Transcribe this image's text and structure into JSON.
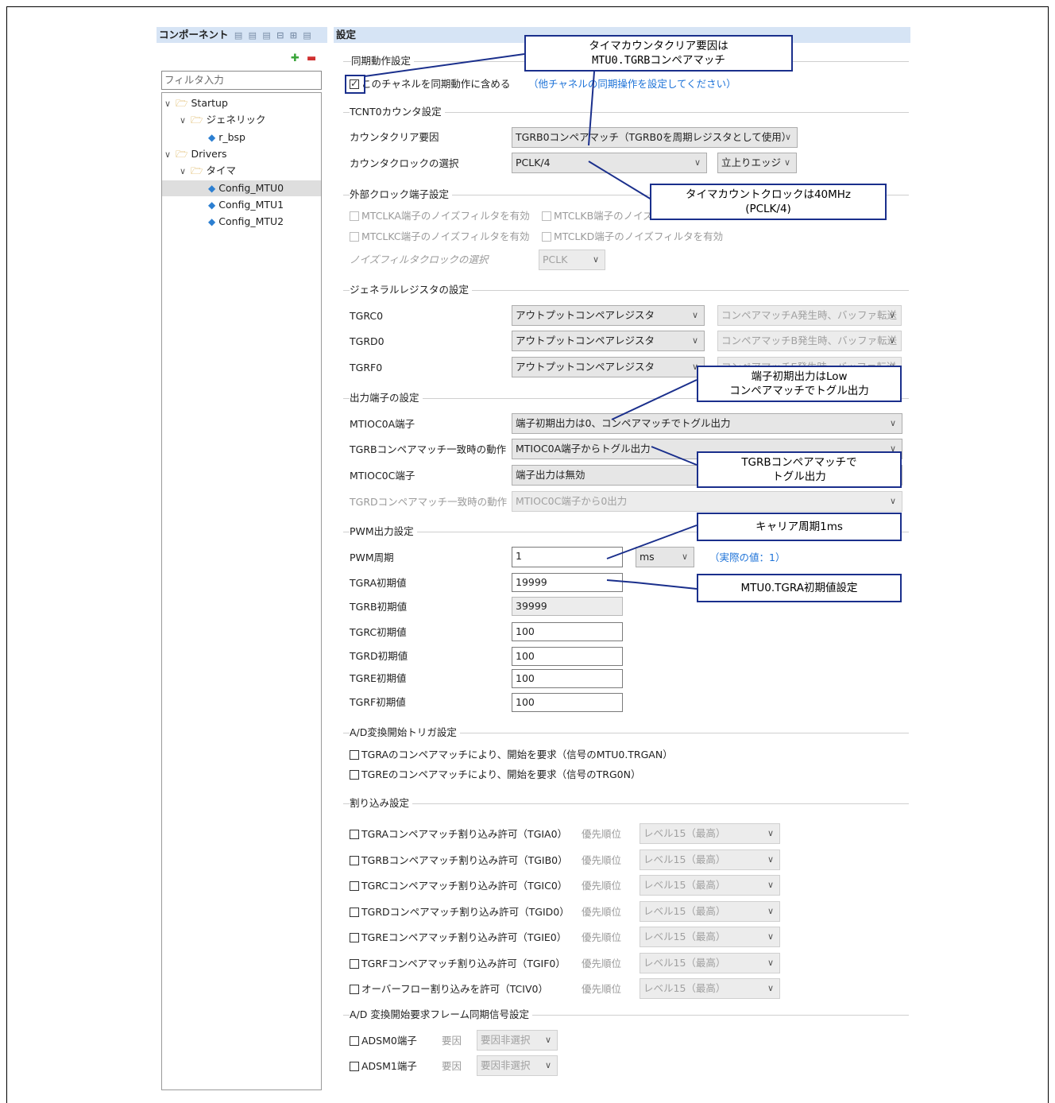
{
  "left_panel": {
    "title": "コンポーネント",
    "toolbar_icons": [
      "▤",
      "▤",
      "▤",
      "⊟",
      "⊞",
      "▤"
    ],
    "filter_placeholder": "フィルタ入力",
    "tree": [
      {
        "label": "Startup",
        "level": 0,
        "type": "folder"
      },
      {
        "label": "ジェネリック",
        "level": 1,
        "type": "folder"
      },
      {
        "label": "r_bsp",
        "level": 2,
        "type": "item"
      },
      {
        "label": "Drivers",
        "level": 0,
        "type": "folder"
      },
      {
        "label": "タイマ",
        "level": 1,
        "type": "folder"
      },
      {
        "label": "Config_MTU0",
        "level": 2,
        "type": "item",
        "selected": true
      },
      {
        "label": "Config_MTU1",
        "level": 2,
        "type": "item"
      },
      {
        "label": "Config_MTU2",
        "level": 2,
        "type": "item"
      }
    ]
  },
  "settings": {
    "title": "設定",
    "sync": {
      "group": "同期動作設定",
      "checkbox_label": "このチャネルを同期動作に含める",
      "link": "（他チャネルの同期操作を設定してください）"
    },
    "tcnt": {
      "group": "TCNT0カウンタ設定",
      "clear_label": "カウンタクリア要因",
      "clear_value": "TGRB0コンペアマッチ（TGRB0を周期レジスタとして使用）",
      "clock_label": "カウンタクロックの選択",
      "clock_value": "PCLK/4",
      "edge_value": "立上りエッジ"
    },
    "ext_clock": {
      "group": "外部クロック端子設定",
      "a": "MTCLKA端子のノイズフィルタを有効",
      "b": "MTCLKB端子のノイズフィルタを有効",
      "c": "MTCLKC端子のノイズフィルタを有効",
      "d": "MTCLKD端子のノイズフィルタを有効",
      "nf_label": "ノイズフィルタクロックの選択",
      "nf_value": "PCLK"
    },
    "general_regs": {
      "group": "ジェネラルレジスタの設定",
      "rows": [
        {
          "label": "TGRC0",
          "value": "アウトプットコンペアレジスタ",
          "buffer": "コンペアマッチA発生時、バッファ転送"
        },
        {
          "label": "TGRD0",
          "value": "アウトプットコンペアレジスタ",
          "buffer": "コンペアマッチB発生時、バッファ転送"
        },
        {
          "label": "TGRF0",
          "value": "アウトプットコンペアレジスタ",
          "buffer": "コンペアマッチE発生時、バッファ転送"
        }
      ]
    },
    "output_pins": {
      "group": "出力端子の設定",
      "rows": [
        {
          "label": "MTIOC0A端子",
          "value": "端子初期出力は0、コンペアマッチでトグル出力"
        },
        {
          "label": "TGRBコンペアマッチ一致時の動作",
          "value": "MTIOC0A端子からトグル出力"
        },
        {
          "label": "MTIOC0C端子",
          "value": "端子出力は無効"
        },
        {
          "label": "TGRDコンペアマッチ一致時の動作",
          "value": "MTIOC0C端子から0出力"
        }
      ]
    },
    "pwm": {
      "group": "PWM出力設定",
      "period_label": "PWM周期",
      "period_value": "1",
      "unit": "ms",
      "actual": "（実際の値：1）",
      "rows": [
        {
          "label": "TGRA初期値",
          "value": "19999"
        },
        {
          "label": "TGRB初期値",
          "value": "39999"
        },
        {
          "label": "TGRC初期値",
          "value": "100"
        },
        {
          "label": "TGRD初期値",
          "value": "100"
        },
        {
          "label": "TGRE初期値",
          "value": "100"
        },
        {
          "label": "TGRF初期値",
          "value": "100"
        }
      ]
    },
    "ad_trigger": {
      "group": "A/D変換開始トリガ設定",
      "a": "TGRAのコンペアマッチにより、開始を要求（信号のMTU0.TRGAN）",
      "e": "TGREのコンペアマッチにより、開始を要求（信号のTRG0N）"
    },
    "interrupts": {
      "group": "割り込み設定",
      "priority_label": "優先順位",
      "priority_value": "レベル15（最高）",
      "rows": [
        "TGRAコンペアマッチ割り込み許可（TGIA0）",
        "TGRBコンペアマッチ割り込み許可（TGIB0）",
        "TGRCコンペアマッチ割り込み許可（TGIC0）",
        "TGRDコンペアマッチ割り込み許可（TGID0）",
        "TGREコンペアマッチ割り込み許可（TGIE0）",
        "TGRFコンペアマッチ割り込み許可（TGIF0）",
        "オーバーフロー割り込みを許可（TCIV0）"
      ]
    },
    "adsm": {
      "group": "A/D 変換開始要求フレーム同期信号設定",
      "factor_label": "要因",
      "factor_value": "要因非選択",
      "rows": [
        "ADSM0端子",
        "ADSM1端子"
      ]
    }
  },
  "callouts": {
    "clear": [
      "タイマカウンタクリア要因は",
      "MTU0.TGRBコンペアマッチ"
    ],
    "clock": [
      "タイマカウントクロックは40MHz",
      "(PCLK/4)"
    ],
    "initial": [
      "端子初期出力はLow",
      "コンペアマッチでトグル出力"
    ],
    "toggle": [
      "TGRBコンペアマッチで",
      "トグル出力"
    ],
    "carrier": [
      "キャリア周期1ms"
    ],
    "tgra": [
      "MTU0.TGRA初期値設定"
    ]
  },
  "colors": {
    "header_bg": "#d6e4f5",
    "link": "#1e73d8",
    "callout_border": "#1a2f8c"
  }
}
